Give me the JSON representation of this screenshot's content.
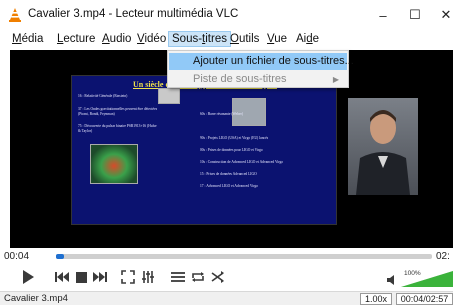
{
  "window": {
    "title": "Cavalier 3.mp4 - Lecteur multimédia VLC",
    "icon": "vlc-cone-icon",
    "minimize_glyph": "–",
    "maximize_glyph": "☐",
    "close_glyph": "✕"
  },
  "menubar": {
    "items": [
      {
        "label": "Média",
        "mnemonic": "M",
        "rest": "édia"
      },
      {
        "label": "Lecture",
        "mnemonic": "L",
        "rest": "ecture"
      },
      {
        "label": "Audio",
        "mnemonic": "A",
        "rest": "udio"
      },
      {
        "label": "Vidéo",
        "mnemonic": "V",
        "rest": "idéo"
      },
      {
        "label": "Sous-titres",
        "pre": "Sous-",
        "mnemonic": "t",
        "rest": "itres"
      },
      {
        "label": "Outils",
        "mnemonic": "O",
        "rest": "utils"
      },
      {
        "label": "Vue",
        "mnemonic": "V",
        "rest": "ue"
      },
      {
        "label": "Aide",
        "pre": "Ai",
        "mnemonic": "d",
        "rest": "e"
      }
    ]
  },
  "subtitle_menu": {
    "items": [
      {
        "label": "Ajouter un fichier de sous-titres...",
        "enabled": true,
        "highlighted": true
      },
      {
        "label": "Piste de sous-titres",
        "enabled": false,
        "has_submenu": true
      }
    ]
  },
  "video": {
    "slide_title": "Un siècle de Développements Scientifiques",
    "slide_lines": [
      "16 : Relativité Générale (Einstein)",
      "37 : Les Ondes gravitationnelles peuvent être détectées (Pirani, Bondi, Feynman)",
      "75 : Découverte du pulsar binaire PSR1913+16 (Hulse & Taylor)",
      "60s : Barre résonante (Weber)",
      "90s : Projets LIGO (USA) et Virgo (EU) lancés",
      "00s : Prises de données pour LIGO et Virgo",
      "10s : Construction de Advanced LIGO et Advanced Virgo",
      "15 : Prises de données Advanced LIGO",
      "17 : Advanced LIGO et Advanced Virgo"
    ]
  },
  "playback": {
    "elapsed": "00:04",
    "total": "02:",
    "progress": 0.02,
    "volume_label": "100%",
    "volume": 1.0
  },
  "controls": {
    "play": "play-icon",
    "prev": "previous-icon",
    "stop": "stop-icon",
    "next": "next-icon",
    "fullscreen": "fullscreen-icon",
    "extended": "equalizer-icon",
    "playlist": "playlist-icon",
    "loop": "loop-icon",
    "shuffle": "shuffle-icon",
    "volume_icon": "speaker-icon"
  },
  "statusbar": {
    "filename": "Cavalier 3.mp4",
    "speed": "1.00x",
    "time": "00:04/02:57"
  },
  "colors": {
    "accent": "#1e6fd0",
    "menu_highlight": "#91c9f7",
    "volume_green": "#3bb33b",
    "vlc_orange": "#f07f00"
  }
}
